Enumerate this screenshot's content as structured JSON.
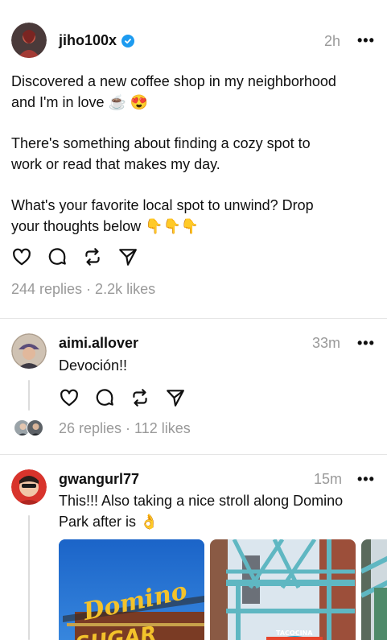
{
  "post1": {
    "username": "jiho100x",
    "time": "2h",
    "more": "•••",
    "line1": "Discovered a new coffee shop in my neighborhood",
    "line2": "and I'm in love ☕ 😍",
    "line3": "There's something about finding a cozy spot to",
    "line4": "work or read that makes my day.",
    "line5": "What's your favorite local spot to unwind? Drop",
    "line6": "your thoughts below 👇👇👇",
    "stats": "244 replies · 2.2k likes"
  },
  "post2": {
    "username": "aimi.allover",
    "time": "33m",
    "more": "•••",
    "text": "Devoción!!",
    "stats": "26 replies · 112 likes"
  },
  "post3": {
    "username": "gwangurl77",
    "time": "15m",
    "more": "•••",
    "line1": "This!!! Also taking a nice stroll along Domino",
    "line2": "Park after is 👌",
    "image1_sign_top": "Domino",
    "image1_sign_bottom": "SUGAR",
    "image2_stall": "TACOCINA"
  },
  "colors": {
    "verified": "#1d9bf0",
    "muted": "#999999",
    "divider": "#e5e5e5"
  }
}
